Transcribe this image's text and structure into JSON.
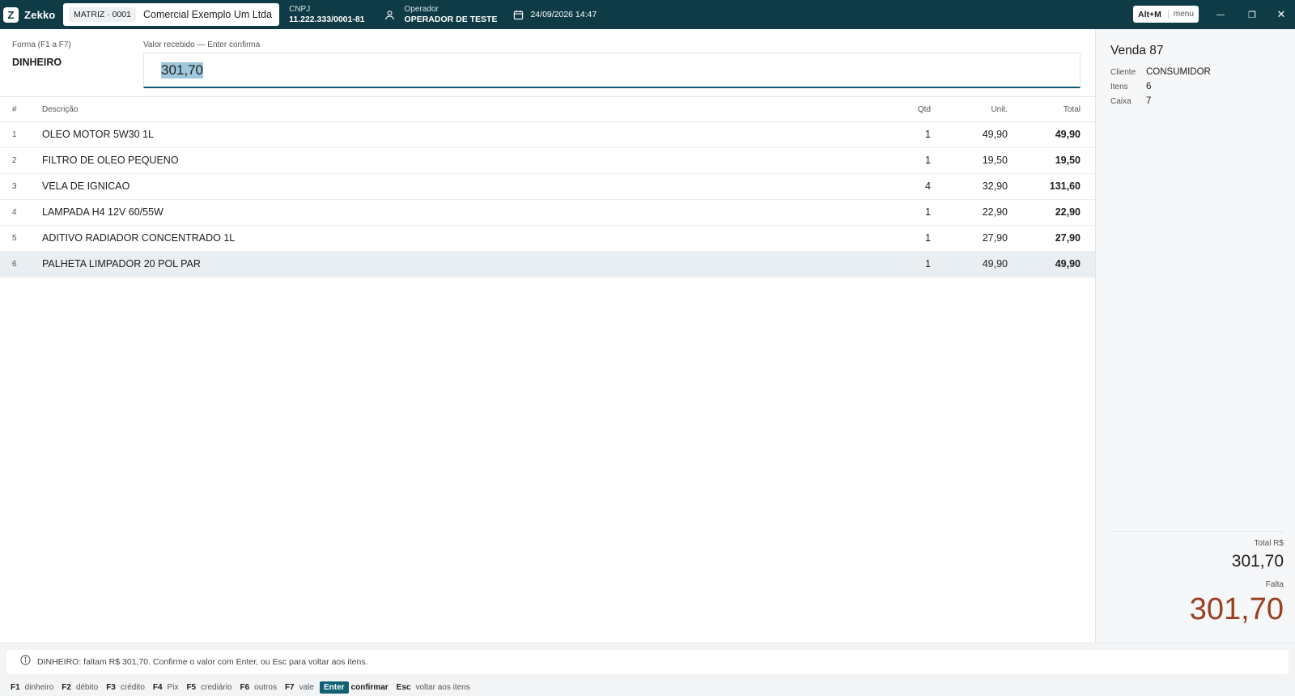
{
  "app": {
    "brand_initial": "Z",
    "brand_name": "Zekko"
  },
  "header": {
    "company_code": "MATRIZ · 0001",
    "company_name": "Comercial Exemplo Um Ltda",
    "cnpj_label": "CNPJ",
    "cnpj_value": "11.222.333/0001-81",
    "operator_label": "Operador",
    "operator_value": "OPERADOR DE TESTE",
    "datetime": "24/09/2026 14:47",
    "menu_shortcut": "Alt+M",
    "menu_label": "menu",
    "window_controls": {
      "minimize": "—",
      "restore": "❐",
      "close": "✕"
    }
  },
  "payment": {
    "method_label": "Forma (F1 a F7)",
    "method_value": "DINHEIRO",
    "amount_label": "Valor recebido — Enter confirma",
    "amount_value": "301,70"
  },
  "table": {
    "headers": {
      "num": "#",
      "description": "Descrição",
      "qty": "Qtd",
      "unit": "Unit.",
      "total": "Total"
    },
    "rows": [
      {
        "num": "1",
        "description": "OLEO MOTOR 5W30 1L",
        "qty": "1",
        "unit": "49,90",
        "total": "49,90"
      },
      {
        "num": "2",
        "description": "FILTRO DE OLEO PEQUENO",
        "qty": "1",
        "unit": "19,50",
        "total": "19,50"
      },
      {
        "num": "3",
        "description": "VELA DE IGNICAO",
        "qty": "4",
        "unit": "32,90",
        "total": "131,60"
      },
      {
        "num": "4",
        "description": "LAMPADA H4 12V 60/55W",
        "qty": "1",
        "unit": "22,90",
        "total": "22,90"
      },
      {
        "num": "5",
        "description": "ADITIVO RADIADOR CONCENTRADO 1L",
        "qty": "1",
        "unit": "27,90",
        "total": "27,90"
      },
      {
        "num": "6",
        "description": "PALHETA LIMPADOR 20 POL PAR",
        "qty": "1",
        "unit": "49,90",
        "total": "49,90"
      }
    ]
  },
  "sale": {
    "title": "Venda 87",
    "client_label": "Cliente",
    "client_value": "CONSUMIDOR",
    "items_label": "Itens",
    "items_value": "6",
    "register_label": "Caixa",
    "register_value": "7",
    "total_label": "Total R$",
    "total_value": "301,70",
    "remaining_label": "Falta",
    "remaining_value": "301,70"
  },
  "status": {
    "message": "DINHEIRO: faltam R$ 301,70. Confirme o valor com Enter, ou Esc para voltar aos itens."
  },
  "shortcuts": [
    {
      "key": "F1",
      "label": "dinheiro"
    },
    {
      "key": "F2",
      "label": "débito"
    },
    {
      "key": "F3",
      "label": "crédito"
    },
    {
      "key": "F4",
      "label": "Pix"
    },
    {
      "key": "F5",
      "label": "crediário"
    },
    {
      "key": "F6",
      "label": "outros"
    },
    {
      "key": "F7",
      "label": "vale"
    },
    {
      "key": "Enter",
      "label": "confirmar"
    },
    {
      "key": "Esc",
      "label": "voltar aos itens"
    }
  ],
  "colors": {
    "titlebar": "#0f3b46",
    "accent": "#0f6073",
    "remaining": "#9a3f20"
  }
}
